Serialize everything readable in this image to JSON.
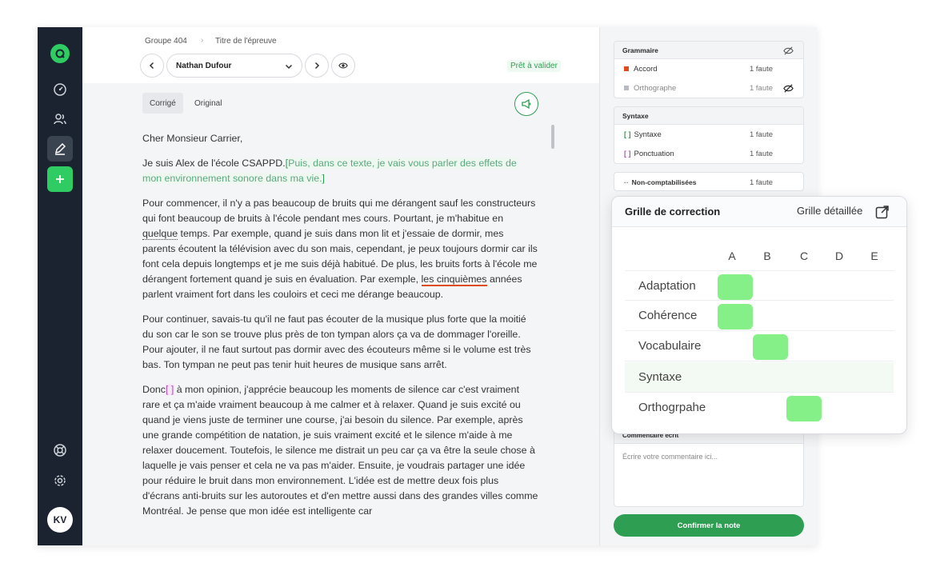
{
  "breadcrumb": {
    "group": "Groupe 404",
    "title": "Titre de l'épreuve"
  },
  "student_select": {
    "value": "Nathan Dufour"
  },
  "status": "Prêt à valider",
  "tabs": {
    "corrected": "Corrigé",
    "original": "Original"
  },
  "avatar": "KV",
  "text": {
    "greeting": "Cher Monsieur Carrier,",
    "p1_a": "Je suis Alex de l'école CSAPPD.",
    "p1_hl": "Puis, dans ce texte, je vais vous parler des effets de mon environnement sonore dans ma vie.",
    "p2_a": "Pour commencer, il n'y a pas beaucoup de bruits qui me dérangent sauf les constructeurs qui font beaucoup de bruits à l'école pendant mes cours. Pourtant, je m'habitue en ",
    "p2_dotted": "quelque",
    "p2_b": " temps. Par exemple, quand je suis dans mon lit et j'essaie de dormir, mes parents écoutent la télévision avec du son mais, cependant, je peux toujours dormir car ils font cela depuis longtemps et je me suis déjà habitué. De plus, les bruits forts à l'école me dérangent fortement quand je suis en évaluation. Par exemple, ",
    "p2_red": "les cinquièmes",
    "p2_c": " années parlent vraiment fort dans les couloirs et ceci me dérange beaucoup.",
    "p3": "Pour continuer, savais-tu qu'il ne faut pas écouter de la musique plus forte que la moitié du son car le son se trouve plus près de ton tympan alors ça va de dommager l'oreille. Pour ajouter, il ne faut surtout pas dormir avec des écouteurs même si le volume est très bas. Ton tympan ne peut pas tenir huit heures de musique sans arrêt.",
    "p4_a": "Donc",
    "p4_b": " à mon opinion, j'apprécie beaucoup les moments de silence car c'est vraiment rare et ça m'aide vraiment beaucoup à me calmer et à relaxer. Quand je suis excité ou quand je viens juste de terminer une course, j'ai besoin du silence. Par exemple, après une grande compétition de natation, je suis vraiment excité et le silence m'aide à me relaxer doucement. Toutefois, le silence me distrait un peu car ça va être la seule chose à laquelle je vais penser et cela ne va pas m'aider. Ensuite, je voudrais partager une idée pour réduire le bruit dans mon environnement. L'idée est de mettre deux fois plus d'écrans anti-bruits sur les autoroutes et d'en mettre aussi dans des grandes villes comme Montréal. Je pense que mon idée est intelligente car"
  },
  "grammar": {
    "title": "Grammaire",
    "rows": [
      {
        "label": "Accord",
        "count": "1 faute",
        "color": "#e04a1f"
      },
      {
        "label": "Orthographe",
        "count": "1 faute",
        "color": "#b8bcc2"
      }
    ]
  },
  "syntax": {
    "title": "Syntaxe",
    "rows": [
      {
        "label": "Syntaxe",
        "count": "1 faute",
        "color": "#2e9e52"
      },
      {
        "label": "Ponctuation",
        "count": "1 faute",
        "color": "#c04ac0"
      }
    ]
  },
  "non_counted": {
    "label": "Non-comptabilisées",
    "count": "1 faute"
  },
  "comment": {
    "title": "Commentaire écrit",
    "placeholder": "Écrire votre commentaire ici..."
  },
  "confirm_button": "Confirmer la note",
  "grid": {
    "title": "Grille de correction",
    "detail": "Grille détaillée",
    "columns": [
      "A",
      "B",
      "C",
      "D",
      "E"
    ],
    "rows": [
      {
        "label": "Adaptation",
        "selected": "A"
      },
      {
        "label": "Cohérence",
        "selected": "A"
      },
      {
        "label": "Vocabulaire",
        "selected": "B"
      },
      {
        "label": "Syntaxe",
        "selected": ""
      },
      {
        "label": "Orthogrpahe",
        "selected": "C"
      }
    ]
  }
}
